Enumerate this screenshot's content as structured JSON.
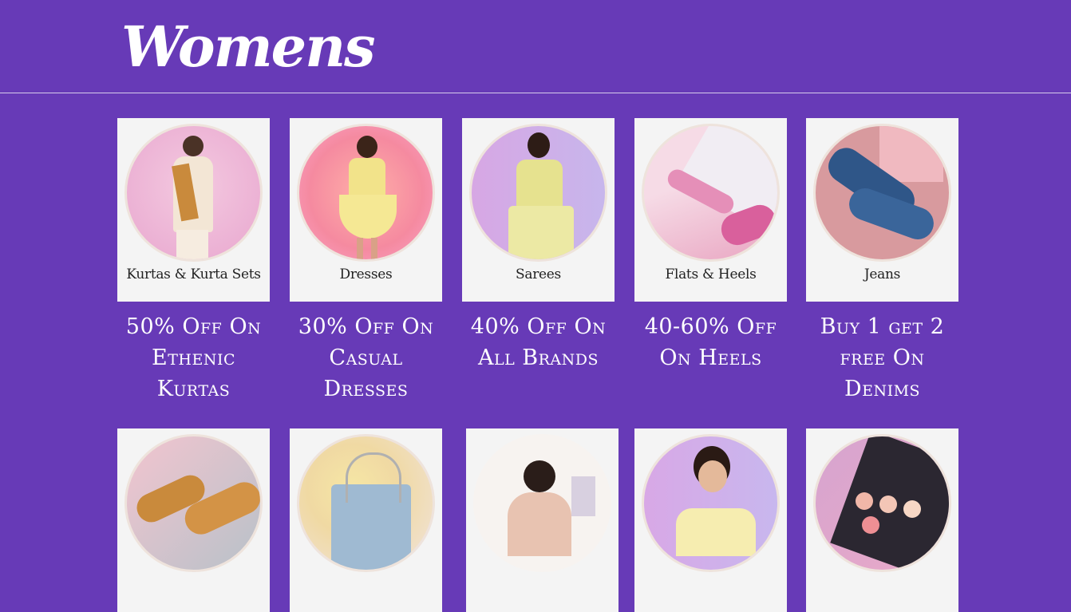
{
  "page": {
    "title": "Womens"
  },
  "colors": {
    "background": "#673ab7",
    "card_bg": "#f4f4f4",
    "text": "#ffffff"
  },
  "row1": [
    {
      "image_label": "Kurtas & Kurta Sets",
      "offer": "50% Off On Ethenic Kurtas",
      "icon": "kurta-model-image"
    },
    {
      "image_label": "Dresses",
      "offer": "30% Off On Casual Dresses",
      "icon": "dress-model-image"
    },
    {
      "image_label": "Sarees",
      "offer": "40% Off On All Brands",
      "icon": "saree-model-image"
    },
    {
      "image_label": "Flats & Heels",
      "offer": "40-60% Off On Heels",
      "icon": "heels-image"
    },
    {
      "image_label": "Jeans",
      "offer": "Buy 1 get 2 free On Denims",
      "icon": "jeans-image"
    }
  ],
  "row2": [
    {
      "icon": "flat-sandals-image"
    },
    {
      "icon": "handbag-image"
    },
    {
      "icon": "lingerie-model-image"
    },
    {
      "icon": "jewellery-model-image"
    },
    {
      "icon": "makeup-palette-image"
    }
  ]
}
